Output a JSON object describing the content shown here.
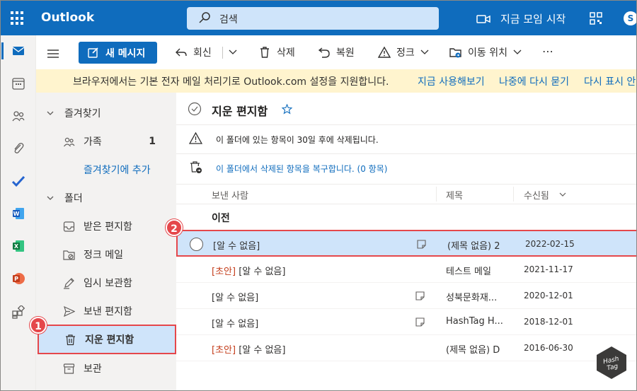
{
  "app": {
    "title": "Outlook"
  },
  "search": {
    "placeholder": "검색"
  },
  "header": {
    "meet_now": "지금 모임 시작",
    "skype": "S"
  },
  "commands": {
    "new_message": "새 메시지",
    "reply": "회신",
    "delete": "삭제",
    "restore": "복원",
    "junk": "정크",
    "move_to": "이동 위치",
    "more": "⋯"
  },
  "banner": {
    "message": "브라우저에서는 기본 전자 메일 처리기로 Outlook.com 설정을 지원합니다.",
    "try_now": "지금 사용해보기",
    "ask_later": "나중에 다시 묻기",
    "dont_show": "다시 표시 안 함"
  },
  "folders": {
    "favorites_header": "즐겨찾기",
    "family": "가족",
    "family_count": "1",
    "add_favorite": "즐겨찾기에 추가",
    "folders_header": "폴더",
    "inbox": "받은 편지함",
    "junk": "정크 메일",
    "drafts": "임시 보관함",
    "sent": "보낸 편지함",
    "deleted": "지운 편지함",
    "archive": "보관"
  },
  "callouts": {
    "one": "1",
    "two": "2"
  },
  "list": {
    "title": "지운 편지함",
    "notice_30days": "이 폴더에 있는 항목이 30일 후에 삭제됩니다.",
    "recover_link": "이 폴더에서 삭제된 항목을 복구합니다. (0 항목)",
    "col_from": "보낸 사람",
    "col_subject": "제목",
    "col_received": "수신됨",
    "group_label": "이전",
    "rows": [
      {
        "draft": "",
        "sender": "[알 수 없음]",
        "subject": "(제목 없음)  2",
        "date": "2022-02-15",
        "note": true
      },
      {
        "draft": "[초안]",
        "sender": " [알 수 없음]",
        "subject": "테스트 메일",
        "date": "2021-11-17",
        "note": false
      },
      {
        "draft": "",
        "sender": "[알 수 없음]",
        "subject": "성북문화재...",
        "date": "2020-12-01",
        "note": true
      },
      {
        "draft": "",
        "sender": "[알 수 없음]",
        "subject": "HashTag   H...",
        "date": "2018-12-01",
        "note": true
      },
      {
        "draft": "[초안]",
        "sender": " [알 수 없음]",
        "subject": "(제목 없음)  D",
        "date": "2016-06-30",
        "note": false
      }
    ]
  },
  "watermark": "HashTag",
  "colors": {
    "brand": "#0f6cbd",
    "highlight": "#cfe4fa",
    "callout": "#e5474b",
    "banner": "#fff4ce",
    "draft": "#c43e1c"
  }
}
